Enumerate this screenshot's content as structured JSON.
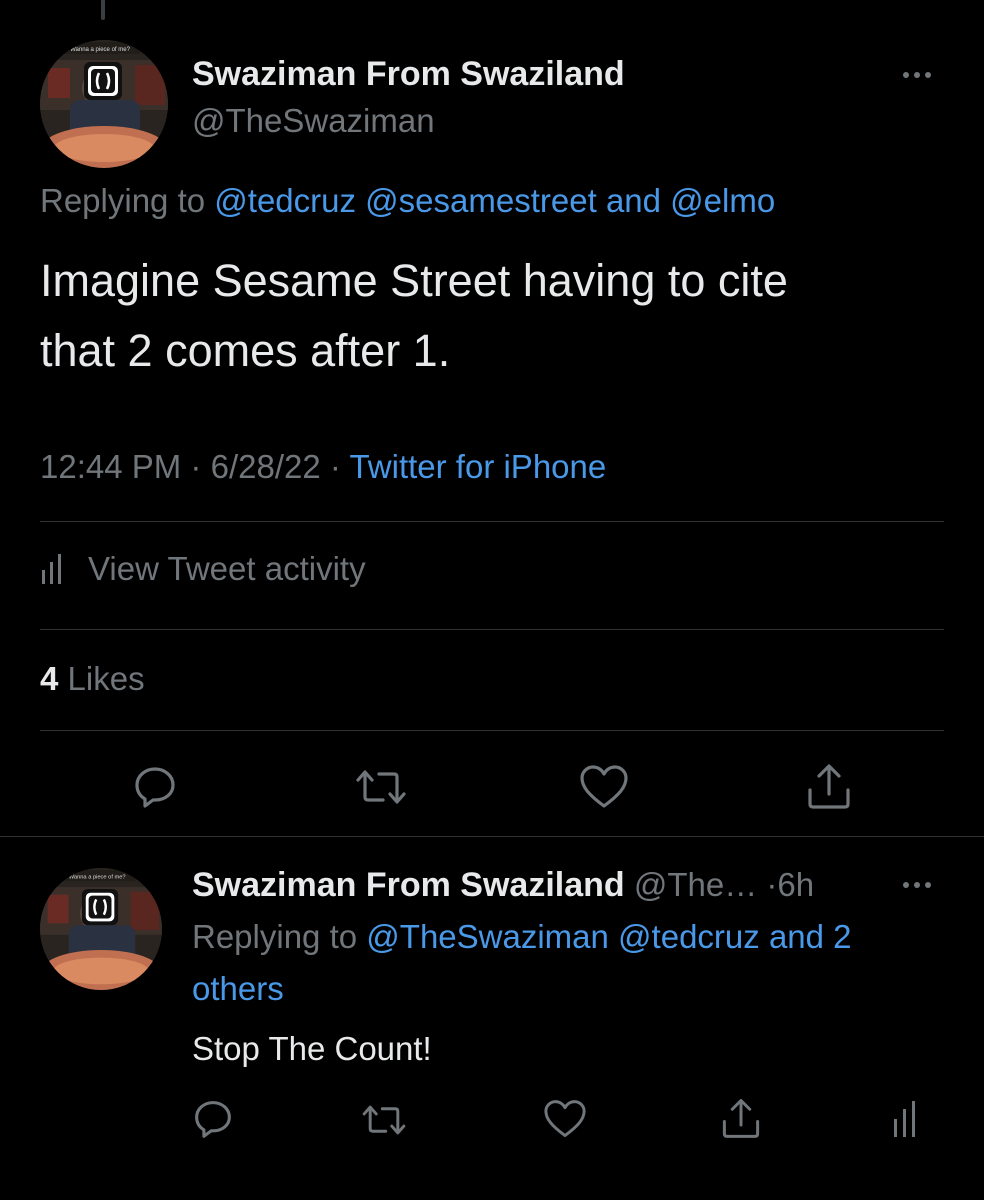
{
  "tweet": {
    "author_name": "Swaziman From Swaziland",
    "author_handle": "@TheSwaziman",
    "replying_prefix": "Replying to",
    "replying_user1": "@tedcruz",
    "replying_user2": "@sesamestreet",
    "replying_and": "and",
    "replying_user3": "@elmo",
    "text_line1": "Imagine Sesame Street having to cite",
    "text_line2": "that 2 comes after 1.",
    "time": "12:44 PM",
    "date": "6/28/22",
    "source": "Twitter for iPhone",
    "separator": "·",
    "activity_label": "View Tweet activity",
    "likes_count": "4",
    "likes_label": "Likes",
    "avatar_caption": "Wanna a piece of me?",
    "actions": [
      "reply-icon",
      "retweet-icon",
      "like-icon",
      "share-icon"
    ]
  },
  "reply": {
    "author_name": "Swaziman From Swaziland",
    "author_handle": "@The…",
    "separator": "·",
    "time_ago": "6h",
    "replying_prefix": "Replying to",
    "replying_user1": "@TheSwaziman",
    "replying_user2": "@tedcruz",
    "replying_and_others": "and 2",
    "replying_others_line2": "others",
    "text": "Stop The Count!",
    "avatar_caption": "Wanna a piece of me?",
    "actions": [
      "reply-icon",
      "retweet-icon",
      "like-icon",
      "share-icon",
      "analytics-icon"
    ]
  },
  "colors": {
    "background": "#000000",
    "text_primary": "#e7e9ea",
    "text_secondary": "#71767b",
    "link": "#4a99e9",
    "divider": "#2f3336"
  }
}
